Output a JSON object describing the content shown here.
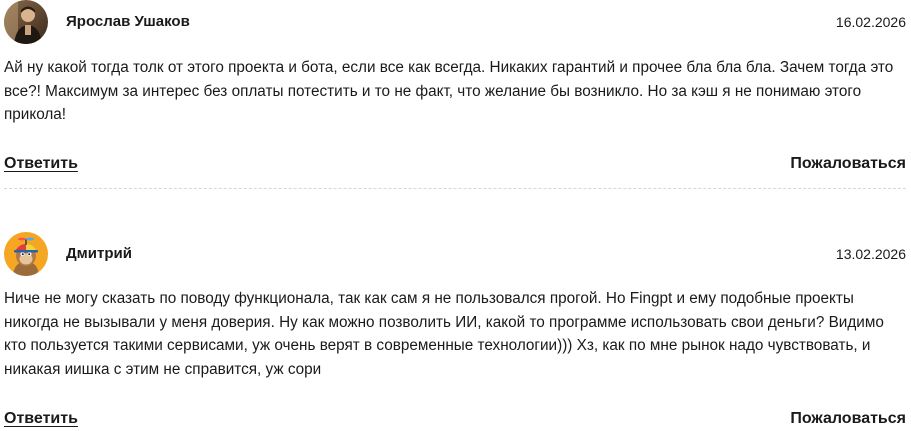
{
  "comments": [
    {
      "author": "Ярослав Ушаков",
      "date": "16.02.2026",
      "text": "Ай ну какой тогда толк от этого проекта и бота, если все как всегда. Никаких гарантий и прочее бла бла бла. Зачем тогда это все?! Максимум за интерес без оплаты потестить и то не факт, что желание бы возникло. Но за кэш я не понимаю этого прикола!",
      "reply_label": "Ответить",
      "report_label": "Пожаловаться"
    },
    {
      "author": "Дмитрий",
      "date": "13.02.2026",
      "text": "Ниче не могу сказать по поводу функционала, так как сам я не пользовался прогой. Но Fingpt и ему подобные проекты никогда не вызывали у меня доверия. Ну как можно позволить ИИ, какой то программе использовать свои деньги? Видимо кто пользуется такими сервисами, уж очень верят в современные технологии))) Хз, как по мне рынок надо чувствовать, и никакая иишка с этим не справится, уж сори",
      "reply_label": "Ответить",
      "report_label": "Пожаловаться"
    }
  ],
  "colors": {
    "text": "#1a1a1a",
    "divider": "#d7d7d7",
    "avatar2_bg": "#f5a623"
  }
}
